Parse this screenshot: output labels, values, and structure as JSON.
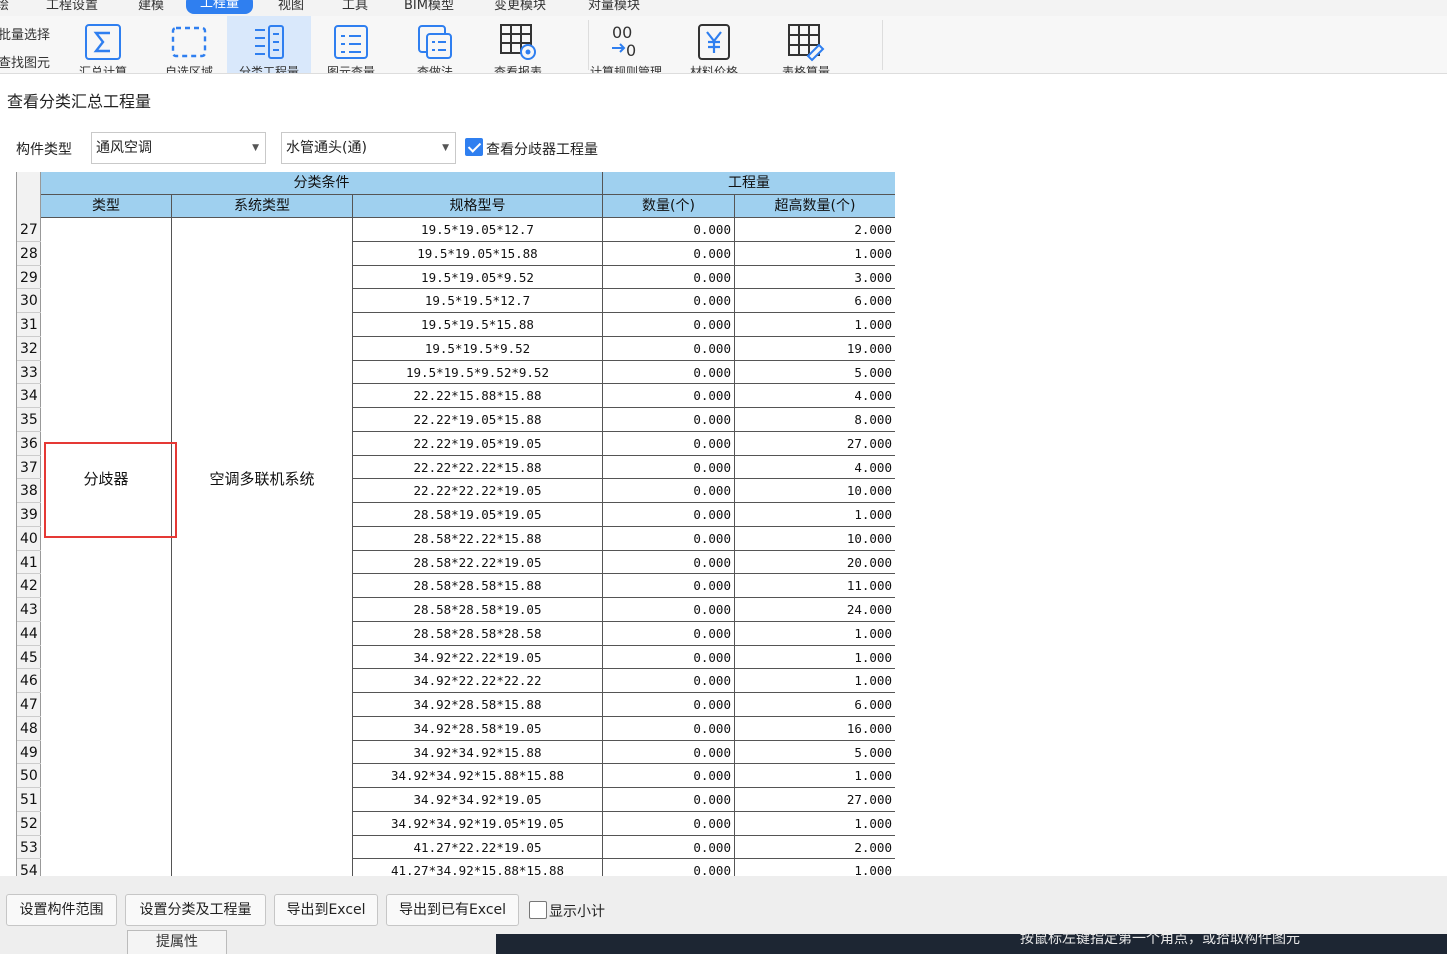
{
  "menubar": {
    "items": [
      "绘",
      "工程设置",
      "建模",
      "工程量",
      "视图",
      "工具",
      "BIM模型",
      "变更模块",
      "对量模块"
    ],
    "active_index": 3
  },
  "ribbon": {
    "left_items": [
      "批量选择",
      "查找图元"
    ],
    "buttons": [
      {
        "icon": "sigma-icon",
        "cut_label": "汇总计算"
      },
      {
        "icon": "dashed-area-icon",
        "cut_label": "自选区域"
      },
      {
        "icon": "category-list-icon",
        "cut_label": "分类工程量",
        "active": true
      },
      {
        "icon": "element-list-icon",
        "cut_label": "图元查量"
      },
      {
        "icon": "calc-detail-icon",
        "cut_label": "查做法"
      },
      {
        "icon": "view-report-icon",
        "cut_label": "查看报表"
      },
      {
        "icon": "calc-rules-icon",
        "cut_label": "计算规则管理"
      },
      {
        "icon": "yen-price-icon",
        "cut_label": "材料价格"
      },
      {
        "icon": "edit-table-icon",
        "cut_label": "表格算量"
      }
    ]
  },
  "dialog": {
    "title": "查看分类汇总工程量",
    "component_type_label": "构件类型",
    "component_type_value": "通风空调",
    "sub_type_value": "水管通头(通)",
    "checkbox_label": "查看分歧器工程量",
    "checkbox_checked": true
  },
  "table": {
    "group_headers": {
      "classification": "分类条件",
      "quantity": "工程量"
    },
    "columns": [
      "类型",
      "系统类型",
      "规格型号",
      "数量(个)",
      "超高数量(个)"
    ],
    "merged_type": "分歧器",
    "merged_system": "空调多联机系统",
    "rows": [
      {
        "n": "27",
        "spec": "19.5*19.05*12.7",
        "qty": "0.000",
        "over": "2.000"
      },
      {
        "n": "28",
        "spec": "19.5*19.05*15.88",
        "qty": "0.000",
        "over": "1.000"
      },
      {
        "n": "29",
        "spec": "19.5*19.05*9.52",
        "qty": "0.000",
        "over": "3.000"
      },
      {
        "n": "30",
        "spec": "19.5*19.5*12.7",
        "qty": "0.000",
        "over": "6.000"
      },
      {
        "n": "31",
        "spec": "19.5*19.5*15.88",
        "qty": "0.000",
        "over": "1.000"
      },
      {
        "n": "32",
        "spec": "19.5*19.5*9.52",
        "qty": "0.000",
        "over": "19.000"
      },
      {
        "n": "33",
        "spec": "19.5*19.5*9.52*9.52",
        "qty": "0.000",
        "over": "5.000"
      },
      {
        "n": "34",
        "spec": "22.22*15.88*15.88",
        "qty": "0.000",
        "over": "4.000"
      },
      {
        "n": "35",
        "spec": "22.22*19.05*15.88",
        "qty": "0.000",
        "over": "8.000"
      },
      {
        "n": "36",
        "spec": "22.22*19.05*19.05",
        "qty": "0.000",
        "over": "27.000"
      },
      {
        "n": "37",
        "spec": "22.22*22.22*15.88",
        "qty": "0.000",
        "over": "4.000"
      },
      {
        "n": "38",
        "spec": "22.22*22.22*19.05",
        "qty": "0.000",
        "over": "10.000"
      },
      {
        "n": "39",
        "spec": "28.58*19.05*19.05",
        "qty": "0.000",
        "over": "1.000"
      },
      {
        "n": "40",
        "spec": "28.58*22.22*15.88",
        "qty": "0.000",
        "over": "10.000"
      },
      {
        "n": "41",
        "spec": "28.58*22.22*19.05",
        "qty": "0.000",
        "over": "20.000"
      },
      {
        "n": "42",
        "spec": "28.58*28.58*15.88",
        "qty": "0.000",
        "over": "11.000"
      },
      {
        "n": "43",
        "spec": "28.58*28.58*19.05",
        "qty": "0.000",
        "over": "24.000"
      },
      {
        "n": "44",
        "spec": "28.58*28.58*28.58",
        "qty": "0.000",
        "over": "1.000"
      },
      {
        "n": "45",
        "spec": "34.92*22.22*19.05",
        "qty": "0.000",
        "over": "1.000"
      },
      {
        "n": "46",
        "spec": "34.92*22.22*22.22",
        "qty": "0.000",
        "over": "1.000"
      },
      {
        "n": "47",
        "spec": "34.92*28.58*15.88",
        "qty": "0.000",
        "over": "6.000"
      },
      {
        "n": "48",
        "spec": "34.92*28.58*19.05",
        "qty": "0.000",
        "over": "16.000"
      },
      {
        "n": "49",
        "spec": "34.92*34.92*15.88",
        "qty": "0.000",
        "over": "5.000"
      },
      {
        "n": "50",
        "spec": "34.92*34.92*15.88*15.88",
        "qty": "0.000",
        "over": "1.000"
      },
      {
        "n": "51",
        "spec": "34.92*34.92*19.05",
        "qty": "0.000",
        "over": "27.000"
      },
      {
        "n": "52",
        "spec": "34.92*34.92*19.05*19.05",
        "qty": "0.000",
        "over": "1.000"
      },
      {
        "n": "53",
        "spec": "41.27*22.22*19.05",
        "qty": "0.000",
        "over": "2.000"
      },
      {
        "n": "54",
        "spec": "41.27*34.92*15.88*15.88",
        "qty": "0.000",
        "over": "1.000"
      }
    ]
  },
  "buttons": {
    "set_range": "设置构件范围",
    "set_classify": "设置分类及工程量",
    "export_excel": "导出到Excel",
    "export_existing": "导出到已有Excel",
    "show_subtotal": "显示小计",
    "show_subtotal_checked": false
  },
  "background": {
    "cut_button": "提属性",
    "status_hint": "按鼠标左键指定第一个角点，或拾取构件图元"
  },
  "colors": {
    "accent": "#2f7ff0",
    "header_bg": "#9fd0ef",
    "highlight": "#e53935"
  }
}
